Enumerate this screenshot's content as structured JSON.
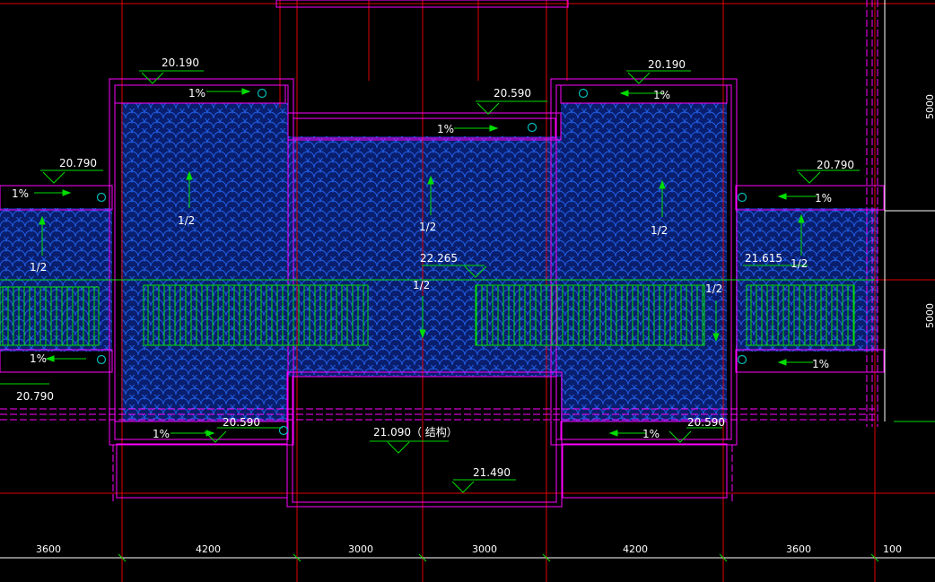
{
  "drawing": {
    "colors": {
      "background": "#000000",
      "axis_red": "#e00000",
      "outline_magenta": "#ff00ff",
      "tile_blue": "#1f5fe6",
      "railing_green": "#00ff00",
      "text_white": "#ffffff",
      "frame_dark": "#0a1e6e"
    },
    "elevations": {
      "left_wing_top": "20.190",
      "right_wing_top": "20.190",
      "center_top": "20.590",
      "left_outer_top": "20.790",
      "right_outer_top": "20.790",
      "left_outer_bottom": "20.790",
      "ridge_center": "22.265",
      "ridge_right": "21.615",
      "bottom_left": "20.590",
      "bottom_right": "20.590",
      "struct": "21.090（ 结构）",
      "lower_center": "21.490"
    },
    "slopes": {
      "gutter_top_left": "1%",
      "gutter_top_right": "1%",
      "gutter_top_center": "1%",
      "gutter_outer_left": "1%",
      "gutter_outer_right": "1%",
      "gutter_outer_left_bottom": "1%",
      "gutter_outer_right_bottom": "1%",
      "gutter_bottom_left": "1%",
      "gutter_bottom_right": "1%",
      "roof_left_wing": "1/2",
      "roof_center": "1/2",
      "roof_center_low": "1/2",
      "roof_right_wing": "1/2",
      "roof_outer_left": "1/2",
      "roof_outer_right": "1/2",
      "roof_right_low": "1/2"
    },
    "dimensions": {
      "bottom": [
        "3600",
        "4200",
        "3000",
        "3000",
        "4200",
        "3600",
        "100"
      ],
      "right": [
        "5000",
        "5000"
      ]
    }
  }
}
